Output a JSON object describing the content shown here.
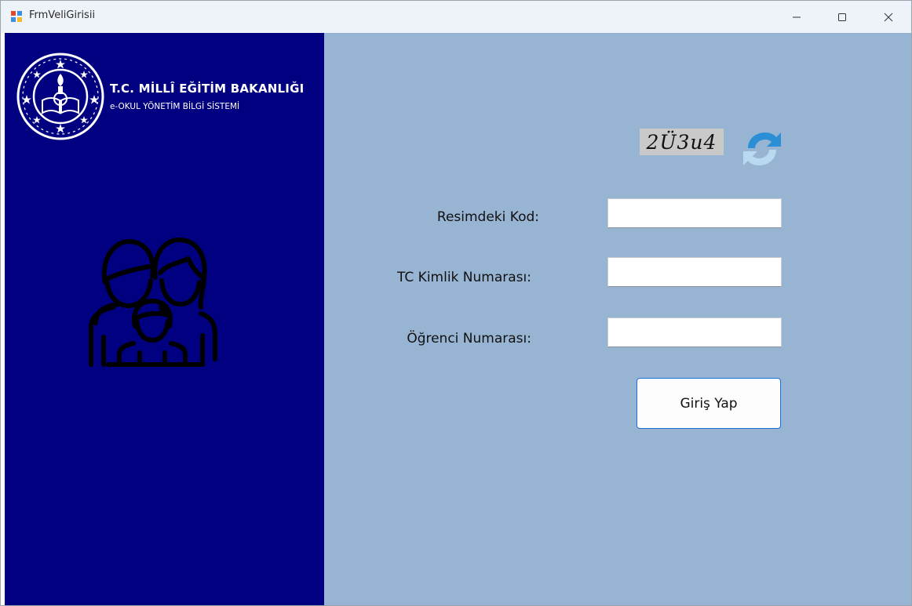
{
  "window": {
    "title": "FrmVeliGirisii"
  },
  "branding": {
    "ministry_title": "T.C. MİLLÎ EĞİTİM BAKANLIĞI",
    "ministry_subtitle": "e-OKUL YÖNETİM BİLGİ SİSTEMİ",
    "seal_icon": "meb-seal-icon",
    "family_icon": "family-icon"
  },
  "form": {
    "captcha_text": "2Ü3u4",
    "refresh_icon": "refresh-icon",
    "code_label": "Resimdeki Kod:",
    "code_value": "",
    "tc_label": "TC Kimlik Numarası:",
    "tc_value": "",
    "student_label": "Öğrenci Numarası:",
    "student_value": "",
    "login_button": "Giriş Yap"
  },
  "colors": {
    "left_panel": "#000080",
    "right_panel": "#98b4d3",
    "button_border": "#1d6fd8"
  }
}
